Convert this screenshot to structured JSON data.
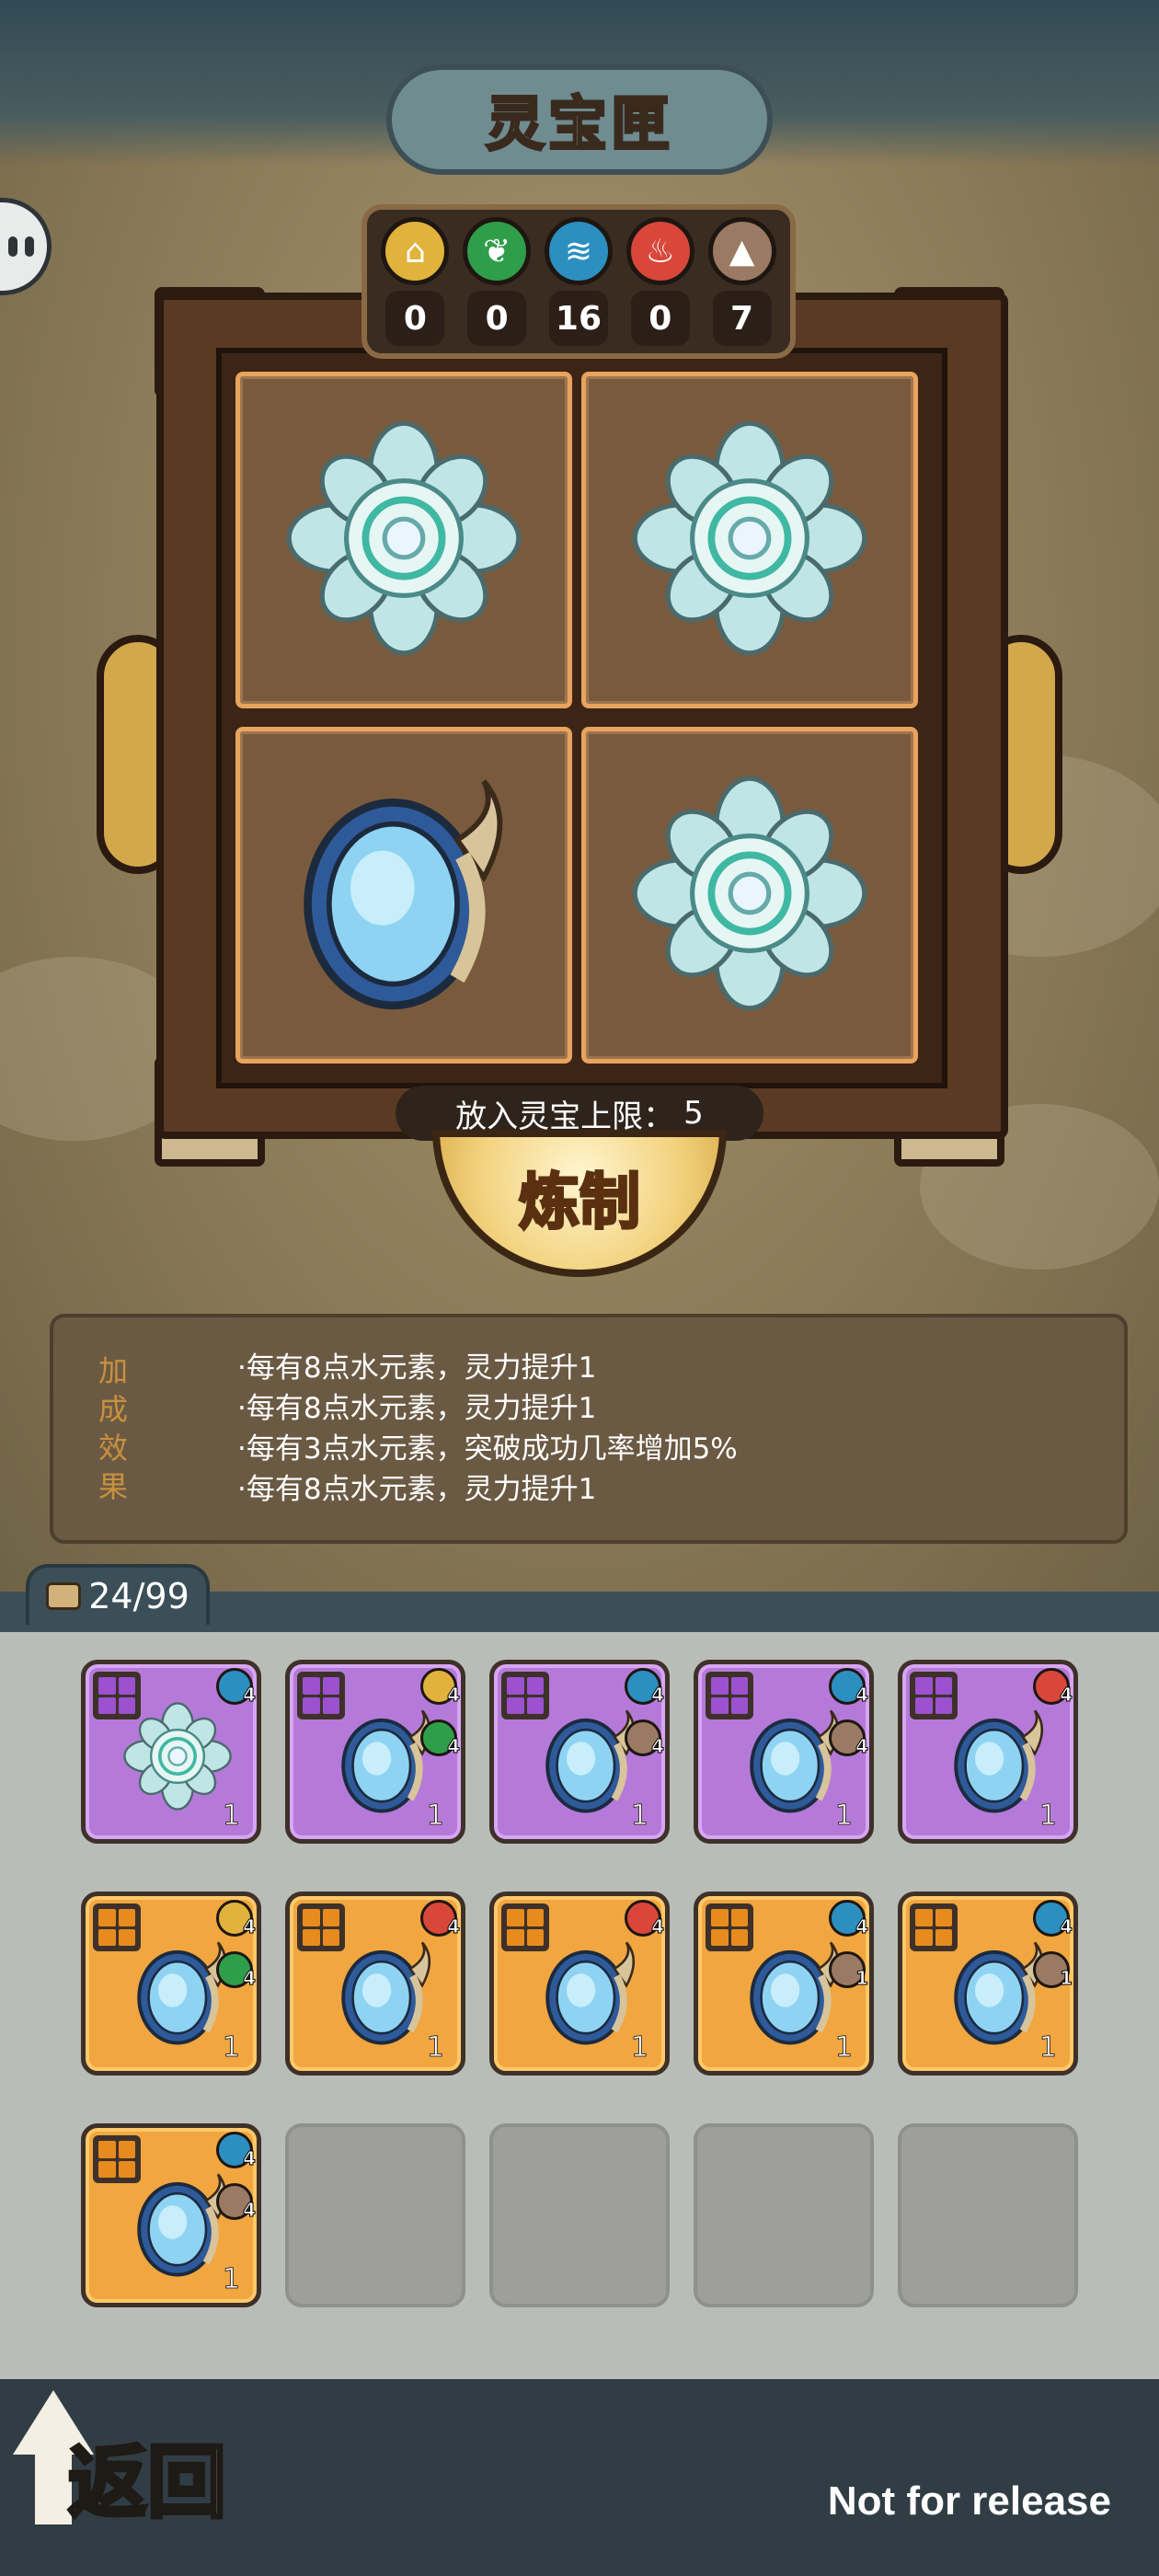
{
  "title": "灵宝匣",
  "elements": [
    {
      "name": "earth-element",
      "icon": "earth-icon",
      "glyph": "⌂",
      "color": "#e1b33c",
      "count": "0"
    },
    {
      "name": "wood-element",
      "icon": "leaf-icon",
      "glyph": "❦",
      "color": "#2f9e4a",
      "count": "0"
    },
    {
      "name": "water-element",
      "icon": "wind-icon",
      "glyph": "≋",
      "color": "#2c8fc0",
      "count": "16"
    },
    {
      "name": "fire-element",
      "icon": "flame-icon",
      "glyph": "♨",
      "color": "#d9473b",
      "count": "0"
    },
    {
      "name": "mountain-element",
      "icon": "mountain-icon",
      "glyph": "▲",
      "color": "#9a7a63",
      "count": "7"
    }
  ],
  "slots": [
    {
      "item": "lotus-treasure-icon"
    },
    {
      "item": "lotus-treasure-icon"
    },
    {
      "item": "mirror-treasure-icon"
    },
    {
      "item": "lotus-treasure-icon"
    }
  ],
  "limit_label": "放入灵宝上限：",
  "limit_value": "5",
  "refine_label": "炼制",
  "bonus": {
    "label_chars": [
      "加",
      "成",
      "效",
      "果"
    ],
    "lines": [
      "·每有8点水元素，灵力提升1",
      "·每有8点水元素，灵力提升1",
      "·每有3点水元素，突破成功几率增加5%",
      "·每有8点水元素，灵力提升1"
    ]
  },
  "inventory": {
    "count": "24/99",
    "rows": [
      [
        {
          "rarity": "purple",
          "item": "lotus",
          "badges": [
            {
              "icon": "wind-icon",
              "color": "#2c8fc0",
              "n": "4"
            }
          ],
          "qty": "1"
        },
        {
          "rarity": "purple",
          "item": "mirror",
          "badges": [
            {
              "icon": "earth-icon",
              "color": "#e1b33c",
              "n": "4"
            },
            {
              "icon": "leaf-icon",
              "color": "#2f9e4a",
              "n": "4"
            }
          ],
          "qty": "1"
        },
        {
          "rarity": "purple",
          "item": "mirror",
          "badges": [
            {
              "icon": "wind-icon",
              "color": "#2c8fc0",
              "n": "4"
            },
            {
              "icon": "mountain-icon",
              "color": "#9a7a63",
              "n": "4"
            }
          ],
          "qty": "1"
        },
        {
          "rarity": "purple",
          "item": "mirror",
          "badges": [
            {
              "icon": "wind-icon",
              "color": "#2c8fc0",
              "n": "4"
            },
            {
              "icon": "mountain-icon",
              "color": "#9a7a63",
              "n": "4"
            }
          ],
          "qty": "1"
        },
        {
          "rarity": "purple",
          "item": "mirror",
          "badges": [
            {
              "icon": "flame-icon",
              "color": "#d9473b",
              "n": "4"
            }
          ],
          "qty": "1"
        }
      ],
      [
        {
          "rarity": "orange",
          "item": "mirror",
          "badges": [
            {
              "icon": "earth-icon",
              "color": "#e1b33c",
              "n": "4"
            },
            {
              "icon": "leaf-icon",
              "color": "#2f9e4a",
              "n": "4"
            }
          ],
          "qty": "1"
        },
        {
          "rarity": "orange",
          "item": "mirror",
          "badges": [
            {
              "icon": "flame-icon",
              "color": "#d9473b",
              "n": "4"
            }
          ],
          "qty": "1"
        },
        {
          "rarity": "orange",
          "item": "mirror",
          "badges": [
            {
              "icon": "flame-icon",
              "color": "#d9473b",
              "n": "4"
            }
          ],
          "qty": "1"
        },
        {
          "rarity": "orange",
          "item": "mirror",
          "badges": [
            {
              "icon": "wind-icon",
              "color": "#2c8fc0",
              "n": "4"
            },
            {
              "icon": "mountain-icon",
              "color": "#9a7a63",
              "n": "1"
            }
          ],
          "qty": "1"
        },
        {
          "rarity": "orange",
          "item": "mirror",
          "badges": [
            {
              "icon": "wind-icon",
              "color": "#2c8fc0",
              "n": "4"
            },
            {
              "icon": "mountain-icon",
              "color": "#9a7a63",
              "n": "1"
            }
          ],
          "qty": "1"
        }
      ],
      [
        {
          "rarity": "orange",
          "item": "mirror",
          "badges": [
            {
              "icon": "wind-icon",
              "color": "#2c8fc0",
              "n": "4"
            },
            {
              "icon": "mountain-icon",
              "color": "#9a7a63",
              "n": "4"
            }
          ],
          "qty": "1"
        },
        {
          "rarity": "empty"
        },
        {
          "rarity": "empty"
        },
        {
          "rarity": "empty"
        },
        {
          "rarity": "empty"
        }
      ]
    ]
  },
  "back_label": "返回",
  "watermark": "Not for release"
}
